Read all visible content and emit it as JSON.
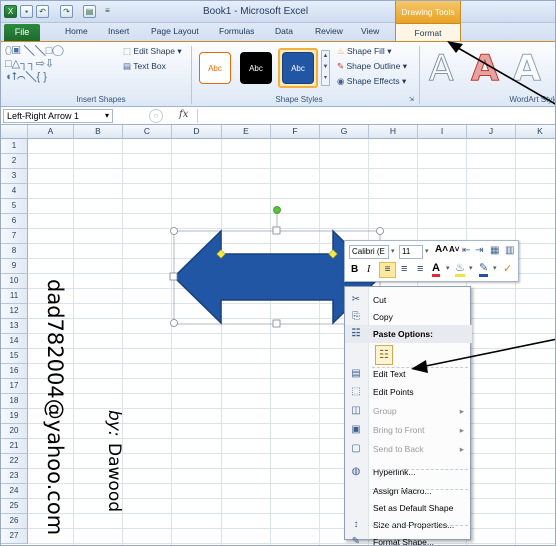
{
  "titlebar": {
    "title": "Book1 - Microsoft Excel",
    "contextual_group": "Drawing Tools",
    "qa_save": "▪",
    "qa_undo": "↶",
    "qa_redo": "↷",
    "qa_print": "▤",
    "qa_more": "≡"
  },
  "tabs": [
    "File",
    "Home",
    "Insert",
    "Page Layout",
    "Formulas",
    "Data",
    "Review",
    "View",
    "Format"
  ],
  "ribbon": {
    "insert_shapes": {
      "label": "Insert Shapes",
      "row1": "⬯▣ ╲╲□◯",
      "row2": "□△┐┐⇨⇩",
      "row3": "◖⭡⌒╲{ }",
      "edit_shape": "Edit Shape",
      "text_box": "Text Box"
    },
    "shape_styles": {
      "label": "Shape Styles",
      "presets": [
        "Abc",
        "Abc",
        "Abc"
      ],
      "shape_fill": "Shape Fill",
      "shape_outline": "Shape Outline",
      "shape_effects": "Shape Effects"
    },
    "wordart": {
      "label": "WordArt Styles",
      "letters": [
        "A",
        "A",
        "A"
      ]
    }
  },
  "formula_bar": {
    "name_box": "Left-Right Arrow 1",
    "fx": "fx"
  },
  "columns": [
    "A",
    "B",
    "C",
    "D",
    "E",
    "F",
    "G",
    "H",
    "I",
    "J",
    "K"
  ],
  "rows": [
    "1",
    "2",
    "3",
    "4",
    "5",
    "6",
    "7",
    "8",
    "9",
    "10",
    "11",
    "12",
    "13",
    "14",
    "15",
    "16",
    "17",
    "18",
    "19",
    "20",
    "21",
    "22",
    "23",
    "24",
    "25",
    "26",
    "27"
  ],
  "watermark": {
    "email": "dad782004@yahoo.com",
    "by": "by:",
    "author": "Dawood"
  },
  "mini_toolbar": {
    "font": "Calibri (E",
    "size": "11",
    "grow": "A˄",
    "shrink": "A˅",
    "bold": "B",
    "italic": "I"
  },
  "context_menu": {
    "items": [
      {
        "label": "Cut",
        "icon": "✂",
        "enabled": true
      },
      {
        "label": "Copy",
        "icon": "⎘",
        "enabled": true
      },
      {
        "label": "Paste Options:",
        "icon": "☷",
        "enabled": true
      },
      {
        "label": "Edit Text",
        "icon": "▤",
        "enabled": true
      },
      {
        "label": "Edit Points",
        "icon": "⬚",
        "enabled": true
      },
      {
        "label": "Group",
        "icon": "◫",
        "enabled": false
      },
      {
        "label": "Bring to Front",
        "icon": "▣",
        "enabled": false
      },
      {
        "label": "Send to Back",
        "icon": "▢",
        "enabled": false
      },
      {
        "label": "Hyperlink...",
        "icon": "◍",
        "enabled": true
      },
      {
        "label": "Assign Macro...",
        "icon": "",
        "enabled": true
      },
      {
        "label": "Set as Default Shape",
        "icon": "",
        "enabled": true
      },
      {
        "label": "Size and Properties...",
        "icon": "↕",
        "enabled": true
      },
      {
        "label": "Format Shape...",
        "icon": "✎",
        "enabled": true
      }
    ]
  },
  "colors": {
    "arrow_fill": "#2156a5",
    "arrow_stroke": "#18407d",
    "format_tab_accent": "#e8a224",
    "file_tab": "#1d6b2d"
  }
}
